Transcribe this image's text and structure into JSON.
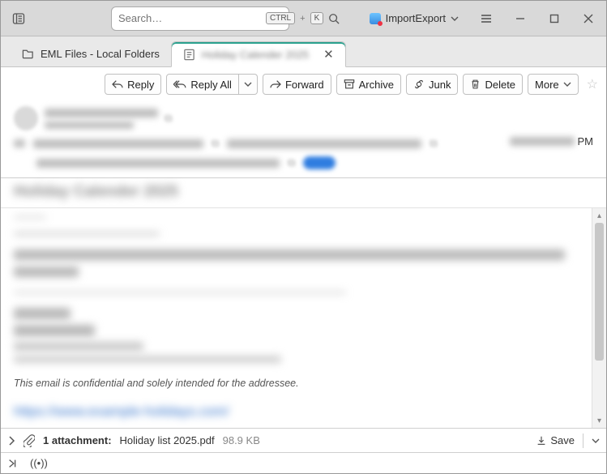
{
  "titlebar": {
    "search_placeholder": "Search…",
    "kbd1": "CTRL",
    "kbd_plus": "+",
    "kbd2": "K",
    "import_label": "ImportExport"
  },
  "tabs": {
    "main_label": "EML Files - Local Folders",
    "msg_label": "Holiday Calender 2025"
  },
  "actions": {
    "reply": "Reply",
    "reply_all": "Reply All",
    "forward": "Forward",
    "archive": "Archive",
    "junk": "Junk",
    "delete": "Delete",
    "more": "More"
  },
  "msg": {
    "pm": "PM",
    "disclaimer": "This email is confidential and solely intended for the addressee."
  },
  "attachment": {
    "count_label": "1 attachment:",
    "name": "Holiday list 2025.pdf",
    "size": "98.9 KB",
    "save": "Save"
  }
}
